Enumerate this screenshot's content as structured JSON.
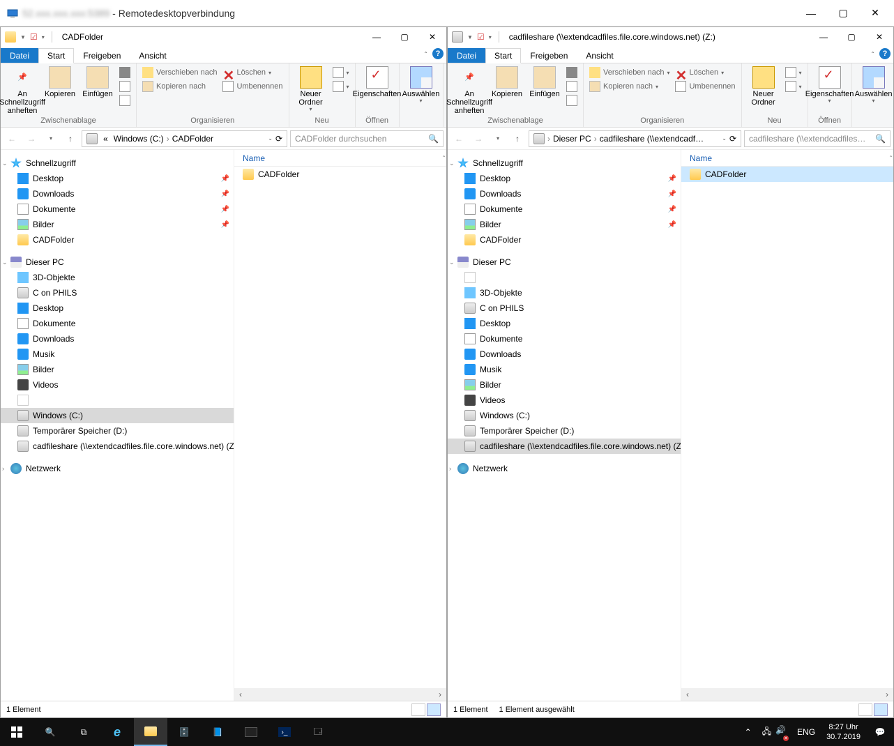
{
  "rdp": {
    "title_suffix": " - Remotedesktopverbindung"
  },
  "tabs": {
    "file": "Datei",
    "start": "Start",
    "freigeben": "Freigeben",
    "ansicht": "Ansicht"
  },
  "ribbon": {
    "pin": "An Schnellzugriff anheften",
    "copy": "Kopieren",
    "paste": "Einfügen",
    "clipboard": "Zwischenablage",
    "move_to": "Verschieben nach",
    "copy_to": "Kopieren nach",
    "delete": "Löschen",
    "rename": "Umbenennen",
    "organize": "Organisieren",
    "new_folder": "Neuer Ordner",
    "new": "Neu",
    "properties": "Eigenschaften",
    "open": "Öffnen",
    "select": "Auswählen"
  },
  "left": {
    "title": "CADFolder",
    "breadcrumb": [
      "Windows (C:)",
      "CADFolder"
    ],
    "search_placeholder": "CADFolder durchsuchen",
    "col_name": "Name",
    "files": [
      {
        "name": "CADFolder",
        "type": "folder",
        "selected": false
      }
    ],
    "status": "1 Element",
    "nav_selected": "Windows (C:)"
  },
  "right": {
    "title": "cadfileshare (\\\\extendcadfiles.file.core.windows.net) (Z:)",
    "breadcrumb": [
      "Dieser PC",
      "cadfileshare (\\\\extendcadf…"
    ],
    "search_placeholder": "cadfileshare (\\\\extendcadfiles.file.core…",
    "col_name": "Name",
    "files": [
      {
        "name": "CADFolder",
        "type": "folder",
        "selected": true
      }
    ],
    "status": "1 Element",
    "status2": "1 Element ausgewählt",
    "nav_selected": "cadfileshare (\\\\extendcadfiles.file.core.windows.net) (Z:)"
  },
  "nav": {
    "schnellzugriff": "Schnellzugriff",
    "desktop": "Desktop",
    "downloads": "Downloads",
    "dokumente": "Dokumente",
    "bilder": "Bilder",
    "cadfolder": "CADFolder",
    "dieser_pc": "Dieser PC",
    "objekte3d": "3D-Objekte",
    "c_on_phils": "C on PHILS",
    "musik": "Musik",
    "videos": "Videos",
    "windows_c": "Windows (C:)",
    "temp_d": "Temporärer Speicher (D:)",
    "cadshare": "cadfileshare (\\\\extendcadfiles.file.core.windows.net) (Z:)",
    "netzwerk": "Netzwerk"
  },
  "taskbar": {
    "lang": "ENG",
    "time": "8:27 Uhr",
    "date": "30.7.2019"
  }
}
